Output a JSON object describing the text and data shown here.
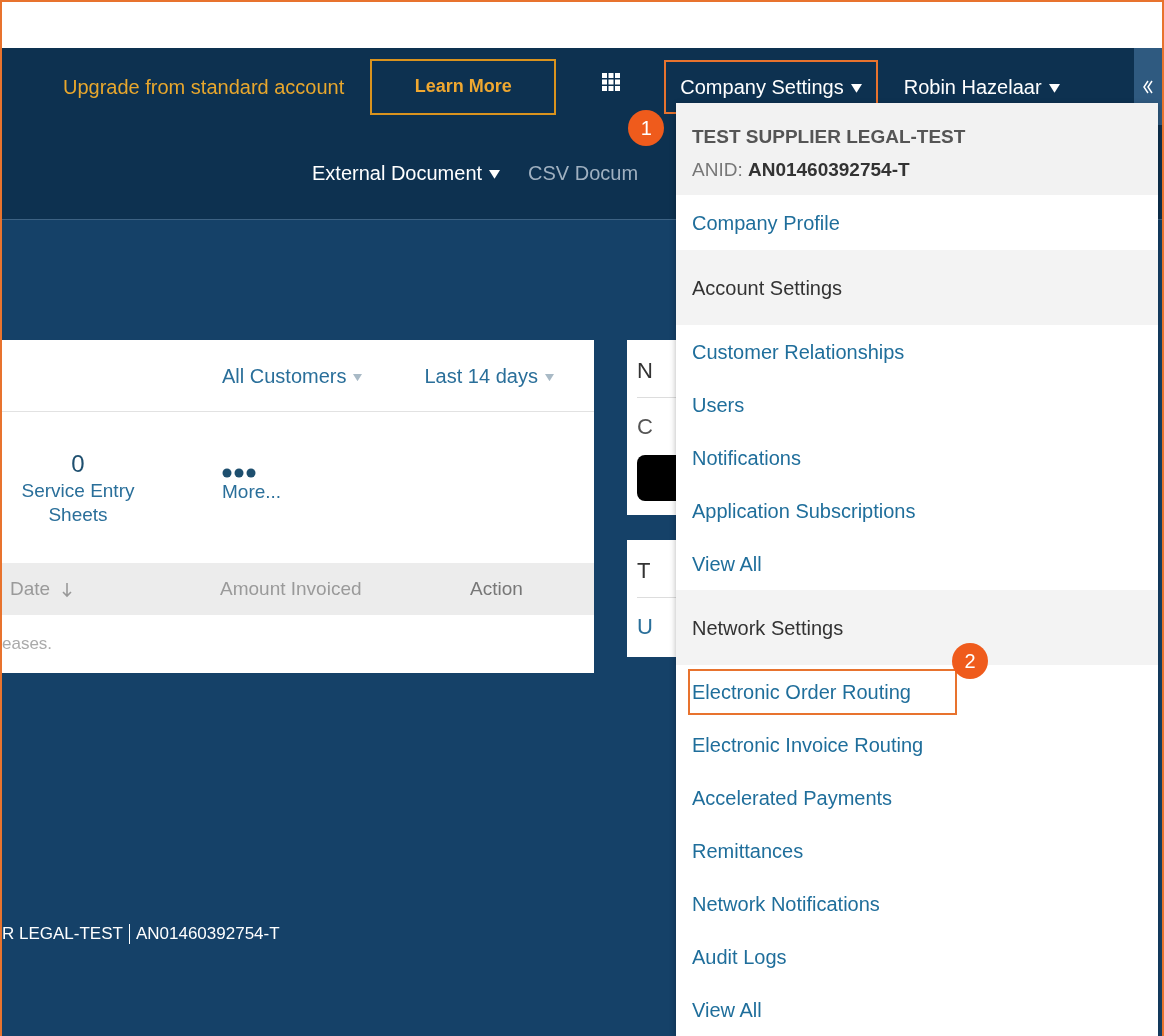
{
  "top_bar": {
    "upgrade_text": "Upgrade from standard account",
    "learn_more_button": "Learn More",
    "menus": [
      {
        "label": "Company Settings",
        "callout": "1"
      },
      {
        "label": "Robin Hazelaar"
      }
    ]
  },
  "sub_nav": [
    {
      "label": "External Document",
      "caret": true
    },
    {
      "label": "CSV Docum",
      "caret": false
    }
  ],
  "dashboard": {
    "filters": [
      "All Customers",
      "Last 14 days"
    ],
    "tiles": [
      {
        "kind": "count",
        "count": "0",
        "label": "Service Entry Sheets"
      },
      {
        "kind": "more",
        "label": "More..."
      }
    ],
    "table": {
      "columns": [
        {
          "label": "Date",
          "sorted": true
        },
        {
          "label": "Amount Invoiced",
          "sorted": false
        },
        {
          "label": "Action",
          "sorted": false
        }
      ],
      "rows": [
        [
          "eases."
        ]
      ]
    }
  },
  "side_cards": [
    {
      "title": "N",
      "items": [
        "C"
      ],
      "tile": true
    },
    {
      "title": "T",
      "items": [
        "U"
      ],
      "tile": false
    }
  ],
  "footer": {
    "company": "R LEGAL-TEST",
    "anid": "AN01460392754-T"
  },
  "dropdown": {
    "company_name": "TEST SUPPLIER LEGAL-TEST",
    "anid_label": "ANID:",
    "anid": "AN01460392754-T",
    "items": [
      {
        "kind": "link",
        "label": "Company Profile"
      },
      {
        "kind": "heading",
        "label": "Account Settings"
      },
      {
        "kind": "link",
        "label": "Customer Relationships"
      },
      {
        "kind": "link",
        "label": "Users"
      },
      {
        "kind": "link",
        "label": "Notifications"
      },
      {
        "kind": "link",
        "label": "Application Subscriptions"
      },
      {
        "kind": "link",
        "label": "View All"
      },
      {
        "kind": "heading",
        "label": "Network Settings"
      },
      {
        "kind": "link",
        "label": "Electronic Order Routing",
        "callout": "2"
      },
      {
        "kind": "link",
        "label": "Electronic Invoice Routing"
      },
      {
        "kind": "link",
        "label": "Accelerated Payments"
      },
      {
        "kind": "link",
        "label": "Remittances"
      },
      {
        "kind": "link",
        "label": "Network Notifications"
      },
      {
        "kind": "link",
        "label": "Audit Logs"
      },
      {
        "kind": "link",
        "label": "View All"
      }
    ]
  }
}
